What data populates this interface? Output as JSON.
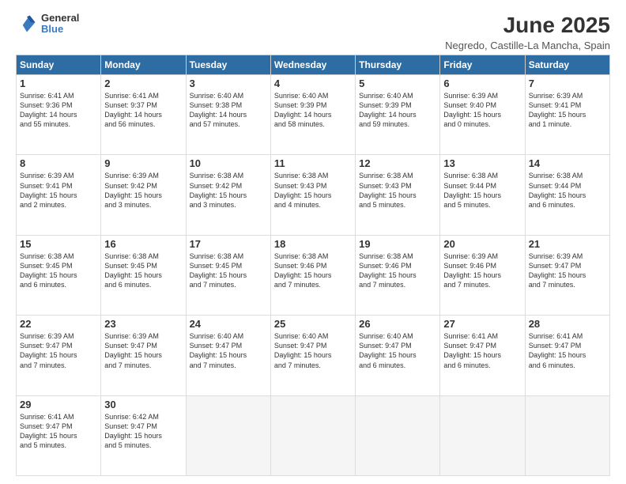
{
  "header": {
    "logo_line1": "General",
    "logo_line2": "Blue",
    "title": "June 2025",
    "subtitle": "Negredo, Castille-La Mancha, Spain"
  },
  "days_of_week": [
    "Sunday",
    "Monday",
    "Tuesday",
    "Wednesday",
    "Thursday",
    "Friday",
    "Saturday"
  ],
  "weeks": [
    [
      {
        "day": "1",
        "lines": [
          "Sunrise: 6:41 AM",
          "Sunset: 9:36 PM",
          "Daylight: 14 hours",
          "and 55 minutes."
        ]
      },
      {
        "day": "2",
        "lines": [
          "Sunrise: 6:41 AM",
          "Sunset: 9:37 PM",
          "Daylight: 14 hours",
          "and 56 minutes."
        ]
      },
      {
        "day": "3",
        "lines": [
          "Sunrise: 6:40 AM",
          "Sunset: 9:38 PM",
          "Daylight: 14 hours",
          "and 57 minutes."
        ]
      },
      {
        "day": "4",
        "lines": [
          "Sunrise: 6:40 AM",
          "Sunset: 9:39 PM",
          "Daylight: 14 hours",
          "and 58 minutes."
        ]
      },
      {
        "day": "5",
        "lines": [
          "Sunrise: 6:40 AM",
          "Sunset: 9:39 PM",
          "Daylight: 14 hours",
          "and 59 minutes."
        ]
      },
      {
        "day": "6",
        "lines": [
          "Sunrise: 6:39 AM",
          "Sunset: 9:40 PM",
          "Daylight: 15 hours",
          "and 0 minutes."
        ]
      },
      {
        "day": "7",
        "lines": [
          "Sunrise: 6:39 AM",
          "Sunset: 9:41 PM",
          "Daylight: 15 hours",
          "and 1 minute."
        ]
      }
    ],
    [
      {
        "day": "8",
        "lines": [
          "Sunrise: 6:39 AM",
          "Sunset: 9:41 PM",
          "Daylight: 15 hours",
          "and 2 minutes."
        ]
      },
      {
        "day": "9",
        "lines": [
          "Sunrise: 6:39 AM",
          "Sunset: 9:42 PM",
          "Daylight: 15 hours",
          "and 3 minutes."
        ]
      },
      {
        "day": "10",
        "lines": [
          "Sunrise: 6:38 AM",
          "Sunset: 9:42 PM",
          "Daylight: 15 hours",
          "and 3 minutes."
        ]
      },
      {
        "day": "11",
        "lines": [
          "Sunrise: 6:38 AM",
          "Sunset: 9:43 PM",
          "Daylight: 15 hours",
          "and 4 minutes."
        ]
      },
      {
        "day": "12",
        "lines": [
          "Sunrise: 6:38 AM",
          "Sunset: 9:43 PM",
          "Daylight: 15 hours",
          "and 5 minutes."
        ]
      },
      {
        "day": "13",
        "lines": [
          "Sunrise: 6:38 AM",
          "Sunset: 9:44 PM",
          "Daylight: 15 hours",
          "and 5 minutes."
        ]
      },
      {
        "day": "14",
        "lines": [
          "Sunrise: 6:38 AM",
          "Sunset: 9:44 PM",
          "Daylight: 15 hours",
          "and 6 minutes."
        ]
      }
    ],
    [
      {
        "day": "15",
        "lines": [
          "Sunrise: 6:38 AM",
          "Sunset: 9:45 PM",
          "Daylight: 15 hours",
          "and 6 minutes."
        ]
      },
      {
        "day": "16",
        "lines": [
          "Sunrise: 6:38 AM",
          "Sunset: 9:45 PM",
          "Daylight: 15 hours",
          "and 6 minutes."
        ]
      },
      {
        "day": "17",
        "lines": [
          "Sunrise: 6:38 AM",
          "Sunset: 9:45 PM",
          "Daylight: 15 hours",
          "and 7 minutes."
        ]
      },
      {
        "day": "18",
        "lines": [
          "Sunrise: 6:38 AM",
          "Sunset: 9:46 PM",
          "Daylight: 15 hours",
          "and 7 minutes."
        ]
      },
      {
        "day": "19",
        "lines": [
          "Sunrise: 6:38 AM",
          "Sunset: 9:46 PM",
          "Daylight: 15 hours",
          "and 7 minutes."
        ]
      },
      {
        "day": "20",
        "lines": [
          "Sunrise: 6:39 AM",
          "Sunset: 9:46 PM",
          "Daylight: 15 hours",
          "and 7 minutes."
        ]
      },
      {
        "day": "21",
        "lines": [
          "Sunrise: 6:39 AM",
          "Sunset: 9:47 PM",
          "Daylight: 15 hours",
          "and 7 minutes."
        ]
      }
    ],
    [
      {
        "day": "22",
        "lines": [
          "Sunrise: 6:39 AM",
          "Sunset: 9:47 PM",
          "Daylight: 15 hours",
          "and 7 minutes."
        ]
      },
      {
        "day": "23",
        "lines": [
          "Sunrise: 6:39 AM",
          "Sunset: 9:47 PM",
          "Daylight: 15 hours",
          "and 7 minutes."
        ]
      },
      {
        "day": "24",
        "lines": [
          "Sunrise: 6:40 AM",
          "Sunset: 9:47 PM",
          "Daylight: 15 hours",
          "and 7 minutes."
        ]
      },
      {
        "day": "25",
        "lines": [
          "Sunrise: 6:40 AM",
          "Sunset: 9:47 PM",
          "Daylight: 15 hours",
          "and 7 minutes."
        ]
      },
      {
        "day": "26",
        "lines": [
          "Sunrise: 6:40 AM",
          "Sunset: 9:47 PM",
          "Daylight: 15 hours",
          "and 6 minutes."
        ]
      },
      {
        "day": "27",
        "lines": [
          "Sunrise: 6:41 AM",
          "Sunset: 9:47 PM",
          "Daylight: 15 hours",
          "and 6 minutes."
        ]
      },
      {
        "day": "28",
        "lines": [
          "Sunrise: 6:41 AM",
          "Sunset: 9:47 PM",
          "Daylight: 15 hours",
          "and 6 minutes."
        ]
      }
    ],
    [
      {
        "day": "29",
        "lines": [
          "Sunrise: 6:41 AM",
          "Sunset: 9:47 PM",
          "Daylight: 15 hours",
          "and 5 minutes."
        ]
      },
      {
        "day": "30",
        "lines": [
          "Sunrise: 6:42 AM",
          "Sunset: 9:47 PM",
          "Daylight: 15 hours",
          "and 5 minutes."
        ]
      },
      {
        "day": "",
        "lines": []
      },
      {
        "day": "",
        "lines": []
      },
      {
        "day": "",
        "lines": []
      },
      {
        "day": "",
        "lines": []
      },
      {
        "day": "",
        "lines": []
      }
    ]
  ]
}
